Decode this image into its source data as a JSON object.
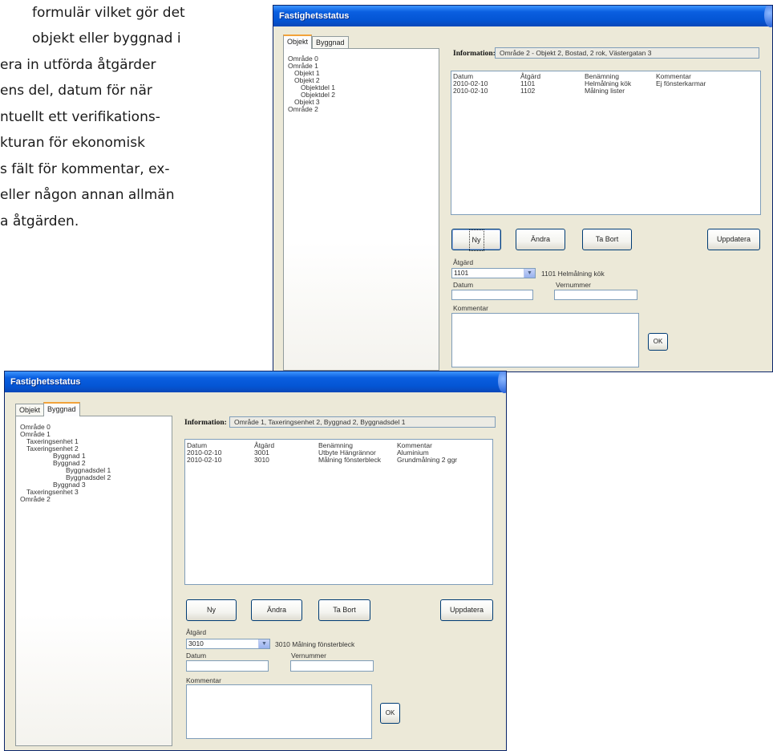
{
  "intro": {
    "lines": [
      "formulär vilket gör det",
      "objekt eller byggnad i",
      "era in utförda åtgärder",
      "ens del, datum för när",
      "ntuellt ett verifikations-",
      "ktura­n för ekonomisk",
      "s fält för kommentar, ex-",
      "eller någon annan allmän",
      "a åtgärden."
    ]
  },
  "window1": {
    "title": "Fastighetsstatus",
    "tabs": [
      "Objekt",
      "Byggnad"
    ],
    "active_tab": "Objekt",
    "tree": [
      "Område 0",
      "Område 1",
      "Objekt 1",
      "Objekt 2",
      "Objektdel 1",
      "Objektdel 2",
      "Objekt 3",
      "Område 2"
    ],
    "info_label": "Information:",
    "info_value": "Område 2 - Objekt 2, Bostad, 2 rok, Västergatan 3",
    "list_header": [
      "Datum",
      "Åtgärd",
      "Benämning",
      "Kommentar"
    ],
    "list_rows": [
      [
        "2010-02-10",
        "1101",
        "Helmålning kök",
        "Ej fönsterkarmar"
      ],
      [
        "2010-02-10",
        "1102",
        "Målning lister",
        ""
      ]
    ],
    "buttons": {
      "new": "Ny",
      "edit": "Ändra",
      "delete": "Ta Bort",
      "update": "Uppdatera",
      "ok": "OK"
    },
    "atgard_label": "Åtgärd",
    "atgard_value": "1101",
    "atgard_desc": "1101 Helmålning kök",
    "datum_label": "Datum",
    "datum_value": "",
    "vernummer_label": "Vernummer",
    "vernummer_value": "",
    "kommentar_label": "Kommentar"
  },
  "window2": {
    "title": "Fastighetsstatus",
    "tabs": [
      "Objekt",
      "Byggnad"
    ],
    "active_tab": "Byggnad",
    "tree": [
      "Område 0",
      "Område 1",
      "Taxeringsenhet 1",
      "Taxeringsenhet 2",
      "Byggnad 1",
      "Byggnad 2",
      "Byggnadsdel 1",
      "Byggnadsdel 2",
      "Byggnad 3",
      "Taxeringsenhet 3",
      "Område 2"
    ],
    "info_label": "Information:",
    "info_value": "Område 1, Taxeringsenhet 2, Byggnad 2, Byggnadsdel 1",
    "list_header": [
      "Datum",
      "Åtgärd",
      "Benämning",
      "Kommentar"
    ],
    "list_rows": [
      [
        "2010-02-10",
        "3001",
        "Utbyte Hängrännor",
        "Aluminium"
      ],
      [
        "2010-02-10",
        "3010",
        "Målning fönsterbleck",
        "Grundmålning 2 ggr"
      ]
    ],
    "buttons": {
      "new": "Ny",
      "edit": "Ändra",
      "delete": "Ta Bort",
      "update": "Uppdatera",
      "ok": "OK"
    },
    "atgard_label": "Åtgärd",
    "atgard_value": "3010",
    "atgard_desc": "3010 Målning fönsterbleck",
    "datum_label": "Datum",
    "datum_value": "",
    "vernummer_label": "Vernummer",
    "vernummer_value": "",
    "kommentar_label": "Kommentar"
  }
}
